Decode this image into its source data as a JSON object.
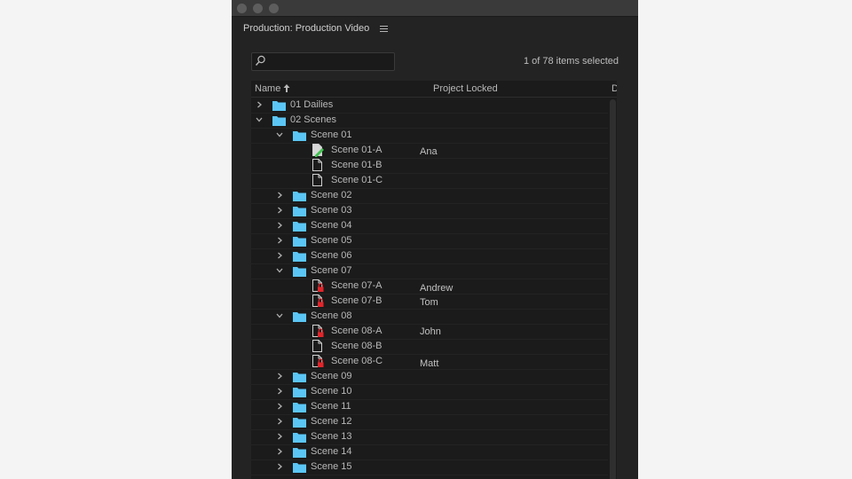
{
  "panel": {
    "title": "Production: Production Video",
    "selection_count": "1 of 78 items selected"
  },
  "search": {
    "value": "",
    "placeholder": ""
  },
  "columns": {
    "name": "Name",
    "project_locked": "Project Locked",
    "third": "D"
  },
  "colors": {
    "folder": "#5bc6f5",
    "lock": "#e0262b",
    "edit": "#3ec24e",
    "panel_bg": "#232323"
  },
  "rows": [
    {
      "label": "01 Dailies",
      "kind": "folder",
      "depth": 0,
      "expanded": false,
      "locked_by": ""
    },
    {
      "label": "02 Scenes",
      "kind": "folder",
      "depth": 0,
      "expanded": true,
      "locked_by": ""
    },
    {
      "label": "Scene 01",
      "kind": "folder",
      "depth": 1,
      "expanded": true,
      "locked_by": ""
    },
    {
      "label": "Scene 01-A",
      "kind": "file",
      "status": "editing",
      "depth": 2,
      "locked_by": "Ana"
    },
    {
      "label": "Scene 01-B",
      "kind": "file",
      "status": "none",
      "depth": 2,
      "locked_by": ""
    },
    {
      "label": "Scene 01-C",
      "kind": "file",
      "status": "none",
      "depth": 2,
      "locked_by": ""
    },
    {
      "label": "Scene 02",
      "kind": "folder",
      "depth": 1,
      "expanded": false,
      "locked_by": ""
    },
    {
      "label": "Scene 03",
      "kind": "folder",
      "depth": 1,
      "expanded": false,
      "locked_by": ""
    },
    {
      "label": "Scene 04",
      "kind": "folder",
      "depth": 1,
      "expanded": false,
      "locked_by": ""
    },
    {
      "label": "Scene 05",
      "kind": "folder",
      "depth": 1,
      "expanded": false,
      "locked_by": ""
    },
    {
      "label": "Scene 06",
      "kind": "folder",
      "depth": 1,
      "expanded": false,
      "locked_by": ""
    },
    {
      "label": "Scene 07",
      "kind": "folder",
      "depth": 1,
      "expanded": true,
      "locked_by": ""
    },
    {
      "label": "Scene 07-A",
      "kind": "file",
      "status": "locked",
      "depth": 2,
      "locked_by": "Andrew"
    },
    {
      "label": "Scene 07-B",
      "kind": "file",
      "status": "locked",
      "depth": 2,
      "locked_by": "Tom"
    },
    {
      "label": "Scene 08",
      "kind": "folder",
      "depth": 1,
      "expanded": true,
      "locked_by": ""
    },
    {
      "label": "Scene 08-A",
      "kind": "file",
      "status": "locked",
      "depth": 2,
      "locked_by": "John"
    },
    {
      "label": "Scene 08-B",
      "kind": "file",
      "status": "none",
      "depth": 2,
      "locked_by": ""
    },
    {
      "label": "Scene 08-C",
      "kind": "file",
      "status": "locked",
      "depth": 2,
      "locked_by": "Matt"
    },
    {
      "label": "Scene 09",
      "kind": "folder",
      "depth": 1,
      "expanded": false,
      "locked_by": ""
    },
    {
      "label": "Scene 10",
      "kind": "folder",
      "depth": 1,
      "expanded": false,
      "locked_by": ""
    },
    {
      "label": "Scene 11",
      "kind": "folder",
      "depth": 1,
      "expanded": false,
      "locked_by": ""
    },
    {
      "label": "Scene 12",
      "kind": "folder",
      "depth": 1,
      "expanded": false,
      "locked_by": ""
    },
    {
      "label": "Scene 13",
      "kind": "folder",
      "depth": 1,
      "expanded": false,
      "locked_by": ""
    },
    {
      "label": "Scene 14",
      "kind": "folder",
      "depth": 1,
      "expanded": false,
      "locked_by": ""
    },
    {
      "label": "Scene 15",
      "kind": "folder",
      "depth": 1,
      "expanded": false,
      "locked_by": ""
    }
  ]
}
